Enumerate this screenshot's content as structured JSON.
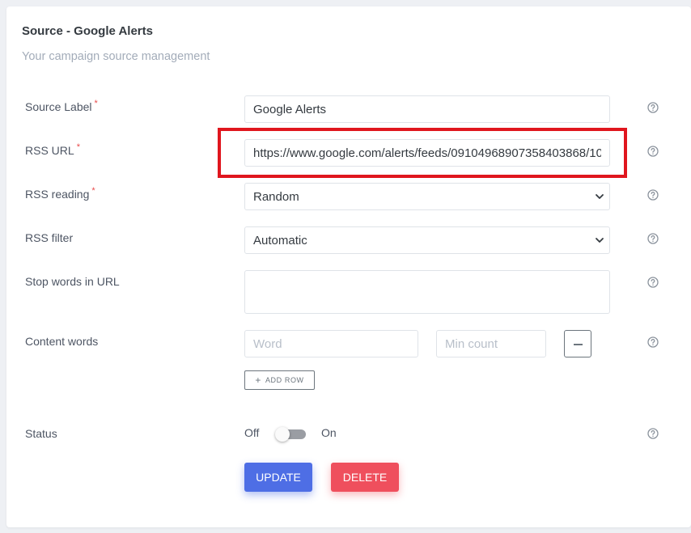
{
  "card": {
    "title": "Source - Google Alerts",
    "subtitle": "Your campaign source management"
  },
  "fields": {
    "source_label": {
      "label": "Source Label",
      "required_mark": "*",
      "value": "Google Alerts"
    },
    "rss_url": {
      "label": "RSS URL",
      "required_mark": "*",
      "value": "https://www.google.com/alerts/feeds/09104968907358403868/10"
    },
    "rss_reading": {
      "label": "RSS reading",
      "required_mark": "*",
      "selected": "Random"
    },
    "rss_filter": {
      "label": "RSS filter",
      "selected": "Automatic"
    },
    "stop_words": {
      "label": "Stop words in URL",
      "value": ""
    },
    "content_words": {
      "label": "Content words",
      "word_placeholder": "Word",
      "min_count_placeholder": "Min count",
      "add_row_label": "ADD ROW"
    },
    "status": {
      "label": "Status",
      "off_label": "Off",
      "on_label": "On",
      "enabled": false
    }
  },
  "actions": {
    "update_label": "UPDATE",
    "delete_label": "DELETE"
  },
  "colors": {
    "primary": "#4e6ee5",
    "danger": "#ef4f5d",
    "required": "#e84a4a",
    "highlight": "#e0161e"
  },
  "icons": {
    "help": "help-circle-icon",
    "chevron": "chevron-down-icon",
    "minus": "minus-icon",
    "plus": "plus-icon"
  }
}
